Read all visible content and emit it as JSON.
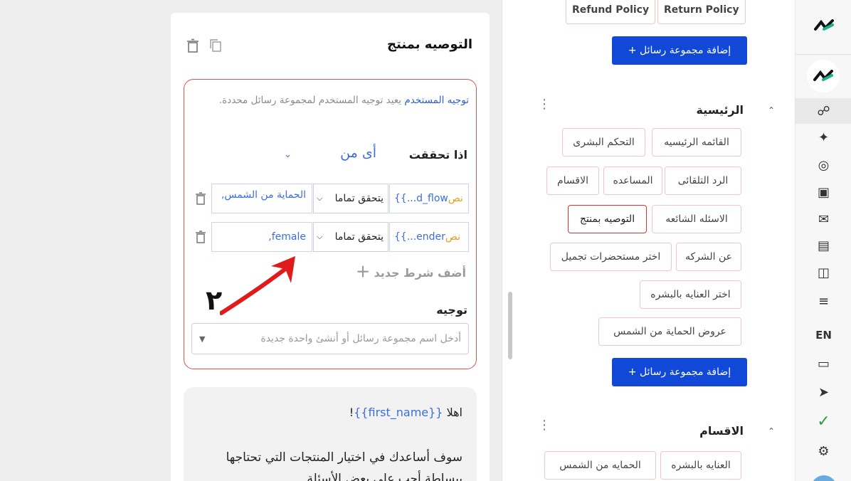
{
  "editor": {
    "title": "التوصيه بمنتج",
    "description_link": "توجيه المستخدم",
    "description_text": " يعيد توجيه المستخدم لمجموعة رسائل محددة.",
    "condition_label": "اذا تحققت",
    "condition_operator": "أى من",
    "conditions": [
      {
        "variable": "{{...d_flow",
        "type": "نص",
        "operator": "يتحقق تماما",
        "value": "الحماية من الشمس,"
      },
      {
        "variable": "{{...ender",
        "type": "نص",
        "operator": "يتحقق تماما",
        "value": "female,"
      }
    ],
    "add_condition": "أضف شرط جديد",
    "annotation_number": "٢",
    "route_label": "توجيه",
    "route_placeholder": "أدخل اسم مجموعة رسائل أو أنشئ واحدة جديدة",
    "message_greeting": "اهلا ",
    "message_var": "{{first_name}}",
    "message_bang": "!",
    "message_body": "سوف أساعدك في اختيار المنتجات التي تحتاجها ببساطة أجب على بعض الأسئلة"
  },
  "middle": {
    "top_chips": [
      "Return Policy",
      "Refund Policy"
    ],
    "add_group": "إضافة مجموعة رسائل +",
    "groups": [
      {
        "title": "الرئيسية",
        "chips": [
          "القائمه الرئيسيه",
          "التحكم البشرى",
          "الرد التلقائى",
          "المساعده",
          "الاقسام",
          "الاسئله الشائعه",
          "التوصيه بمنتج",
          "عن الشركه",
          "اختر مستحضرات تجميل",
          "اختر العنايه بالبشره",
          "عروض الحماية من الشمس"
        ],
        "add_group": "إضافة مجموعة رسائل +"
      },
      {
        "title": "الاقسام",
        "chips": [
          "العنايه بالبشره",
          "الحمايه من الشمس"
        ]
      }
    ]
  },
  "nav": {
    "language": "EN"
  },
  "colors": {
    "accent": "#1148d8",
    "danger_border": "#d9534f",
    "link": "#3b6de0",
    "type_tag": "#e0a21b",
    "success": "#2e9b46"
  }
}
